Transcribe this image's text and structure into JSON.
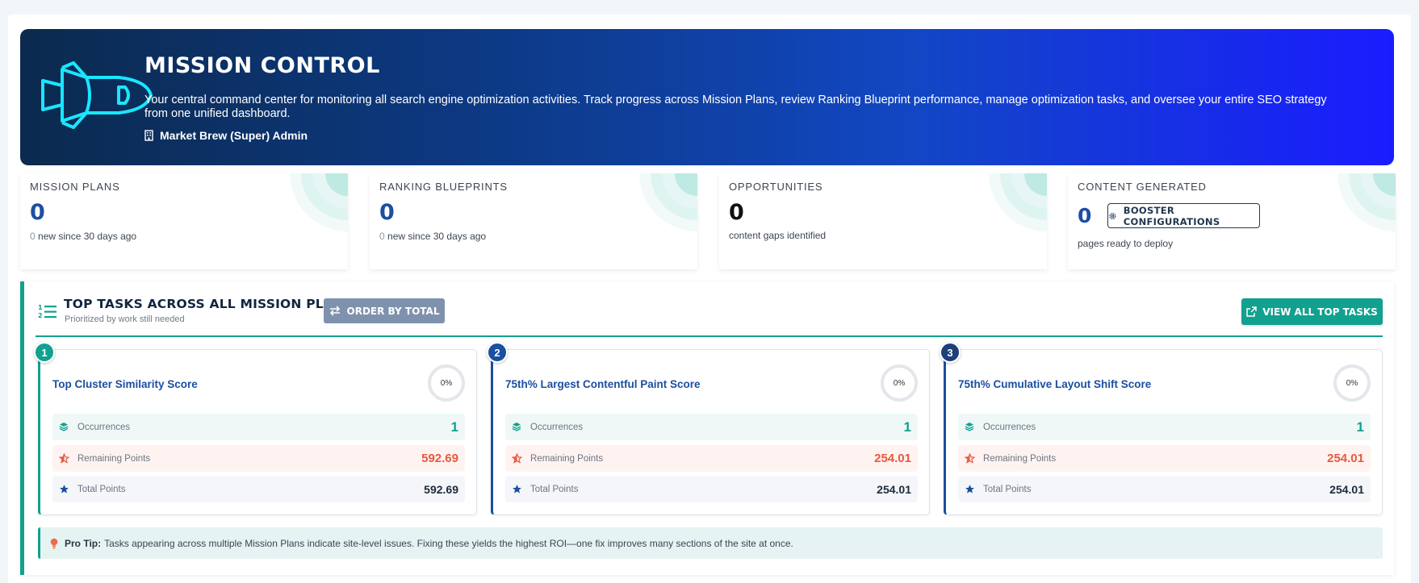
{
  "hero": {
    "title": "Mission Control",
    "description": "Your central command center for monitoring all search engine optimization activities. Track progress across Mission Plans, review Ranking Blueprint performance, manage optimization tasks, and oversee your entire SEO strategy from one unified dashboard.",
    "user": "Market Brew (Super) Admin"
  },
  "stats": [
    {
      "label": "Mission Plans",
      "value": "0",
      "sub_count": "0",
      "sub_text": " new since 30 days ago"
    },
    {
      "label": "Ranking Blueprints",
      "value": "0",
      "sub_count": "0",
      "sub_text": " new since 30 days ago"
    },
    {
      "label": "Opportunities",
      "value": "0",
      "sub_text": "content gaps identified"
    },
    {
      "label": "Content Generated",
      "value": "0",
      "button": "Booster Configurations",
      "sub_text": "pages ready to deploy"
    }
  ],
  "top_tasks": {
    "title": "Top Tasks Across All Mission Plans",
    "subtitle": "Prioritized by work still needed",
    "order_button": "Order by Total",
    "view_all_button": "View All Top Tasks",
    "labels": {
      "occurrences": "Occurrences",
      "remaining": "Remaining Points",
      "total": "Total Points"
    },
    "tasks": [
      {
        "rank": "1",
        "title": "Top Cluster Similarity Score",
        "progress": "0%",
        "occurrences": "1",
        "remaining": "592.69",
        "total": "592.69"
      },
      {
        "rank": "2",
        "title": "75th% Largest Contentful Paint Score",
        "progress": "0%",
        "occurrences": "1",
        "remaining": "254.01",
        "total": "254.01"
      },
      {
        "rank": "3",
        "title": "75th% Cumulative Layout Shift Score",
        "progress": "0%",
        "occurrences": "1",
        "remaining": "254.01",
        "total": "254.01"
      }
    ],
    "pro_tip_label": "Pro Tip:",
    "pro_tip_text": "Tasks appearing across multiple Mission Plans indicate site-level issues. Fixing these yields the highest ROI—one fix improves many sections of the site at once."
  },
  "colors": {
    "teal": "#12a08f",
    "navy": "#1b4fa0",
    "coral": "#e8593f"
  }
}
